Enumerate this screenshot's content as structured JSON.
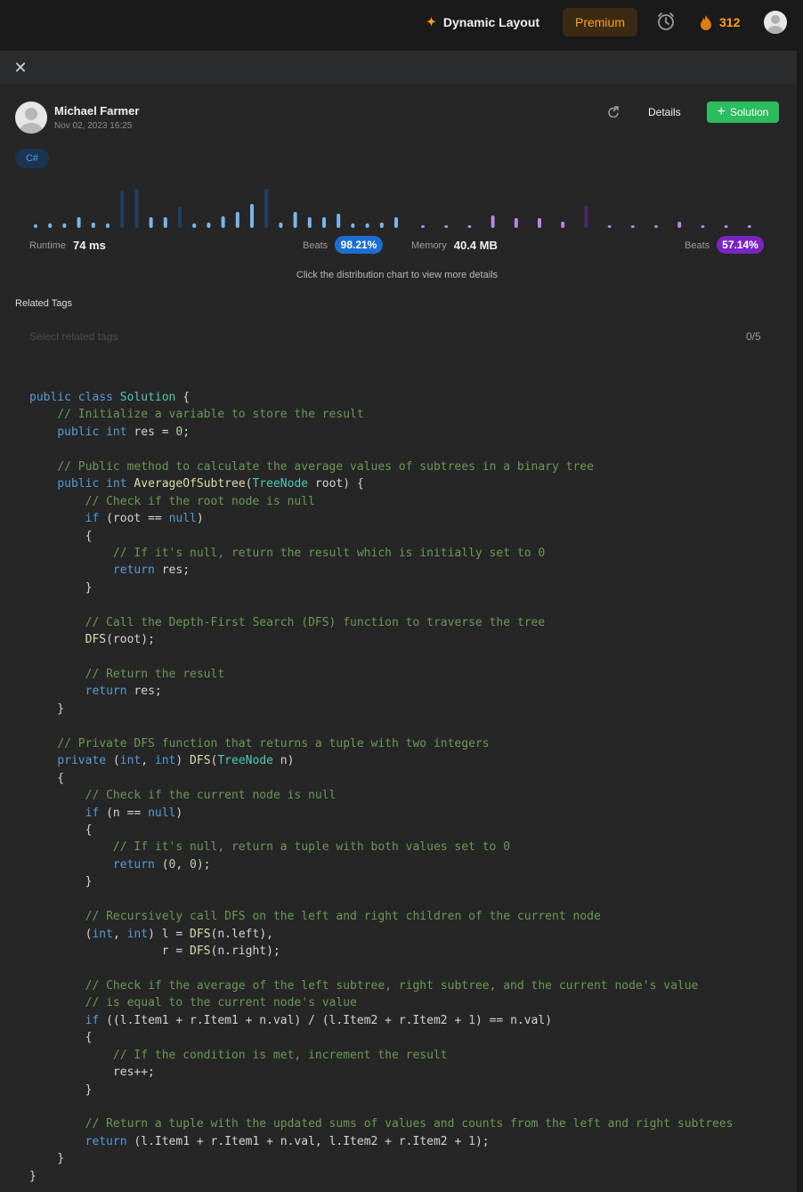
{
  "nav": {
    "layout_label": "Dynamic Layout",
    "premium_label": "Premium",
    "streak_count": "312"
  },
  "author": {
    "name": "Michael Farmer",
    "date": "Nov 02, 2023 16:25"
  },
  "actions": {
    "details_label": "Details",
    "solution_label": "Solution"
  },
  "language": "C#",
  "runtime": {
    "label": "Runtime",
    "value": "74 ms",
    "beats_label": "Beats",
    "beats_value": "98.21%",
    "beats_color": "#1c6fd1",
    "bar_heights": [
      4,
      5,
      5,
      12,
      6,
      5,
      42,
      44,
      12,
      12,
      24,
      5,
      6,
      13,
      18,
      27,
      44,
      6,
      18,
      12,
      12,
      16,
      5,
      5,
      6,
      12
    ],
    "bar_highlight": [
      false,
      false,
      false,
      false,
      false,
      false,
      true,
      true,
      false,
      false,
      true,
      false,
      false,
      false,
      false,
      false,
      true,
      false,
      false,
      false,
      false,
      false,
      false,
      false,
      false,
      false
    ]
  },
  "memory": {
    "label": "Memory",
    "value": "40.4 MB",
    "beats_label": "Beats",
    "beats_value": "57.14%",
    "beats_color": "#7a25c2",
    "bar_heights": [
      3,
      3,
      3,
      14,
      11,
      11,
      7,
      25,
      3,
      3,
      3,
      7,
      3,
      3,
      3
    ],
    "bar_highlight": [
      false,
      false,
      false,
      false,
      false,
      false,
      false,
      true,
      false,
      false,
      false,
      false,
      false,
      false,
      false
    ]
  },
  "chart_hint": "Click the distribution chart to view more details",
  "tags": {
    "label": "Related Tags",
    "placeholder": "Select related tags",
    "count": "0/5"
  },
  "code_lines": [
    [
      [
        "kw",
        "public"
      ],
      [
        "",
        "&nbsp;"
      ],
      [
        "kw",
        "class"
      ],
      [
        "",
        "&nbsp;"
      ],
      [
        "ty",
        "Solution"
      ],
      [
        "",
        "&nbsp;{"
      ]
    ],
    [
      [
        "",
        "    "
      ],
      [
        "cm",
        "// Initialize a variable to store the result"
      ]
    ],
    [
      [
        "",
        "    "
      ],
      [
        "kw",
        "public"
      ],
      [
        "",
        "&nbsp;"
      ],
      [
        "kw",
        "int"
      ],
      [
        "",
        "&nbsp;res = "
      ],
      [
        "nm",
        "0"
      ],
      [
        "",
        ";"
      ]
    ],
    [
      [
        "",
        ""
      ]
    ],
    [
      [
        "",
        "    "
      ],
      [
        "cm",
        "// Public method to calculate the average values of subtrees in a binary tree"
      ]
    ],
    [
      [
        "",
        "    "
      ],
      [
        "kw",
        "public"
      ],
      [
        "",
        "&nbsp;"
      ],
      [
        "kw",
        "int"
      ],
      [
        "",
        "&nbsp;"
      ],
      [
        "fn",
        "AverageOfSubtree"
      ],
      [
        "",
        "("
      ],
      [
        "ty",
        "TreeNode"
      ],
      [
        "",
        "&nbsp;root) {"
      ]
    ],
    [
      [
        "",
        "        "
      ],
      [
        "cm",
        "// Check if the root node is null"
      ]
    ],
    [
      [
        "",
        "        "
      ],
      [
        "kw",
        "if"
      ],
      [
        "",
        "&nbsp;(root == "
      ],
      [
        "kw",
        "null"
      ],
      [
        "",
        ")"
      ]
    ],
    [
      [
        "",
        "        {"
      ]
    ],
    [
      [
        "",
        "            "
      ],
      [
        "cm",
        "// If it's null, return the result which is initially set to 0"
      ]
    ],
    [
      [
        "",
        "            "
      ],
      [
        "kw",
        "return"
      ],
      [
        "",
        "&nbsp;res;"
      ]
    ],
    [
      [
        "",
        "        }"
      ]
    ],
    [
      [
        "",
        ""
      ]
    ],
    [
      [
        "",
        "        "
      ],
      [
        "cm",
        "// Call the Depth-First Search (DFS) function to traverse the tree"
      ]
    ],
    [
      [
        "",
        "        "
      ],
      [
        "fn",
        "DFS"
      ],
      [
        "",
        "(root);"
      ]
    ],
    [
      [
        "",
        ""
      ]
    ],
    [
      [
        "",
        "        "
      ],
      [
        "cm",
        "// Return the result"
      ]
    ],
    [
      [
        "",
        "        "
      ],
      [
        "kw",
        "return"
      ],
      [
        "",
        "&nbsp;res;"
      ]
    ],
    [
      [
        "",
        "    }"
      ]
    ],
    [
      [
        "",
        ""
      ]
    ],
    [
      [
        "",
        "    "
      ],
      [
        "cm",
        "// Private DFS function that returns a tuple with two integers"
      ]
    ],
    [
      [
        "",
        "    "
      ],
      [
        "kw",
        "private"
      ],
      [
        "",
        "&nbsp;("
      ],
      [
        "kw",
        "int"
      ],
      [
        "",
        ",&nbsp;"
      ],
      [
        "kw",
        "int"
      ],
      [
        "",
        ")&nbsp;"
      ],
      [
        "fn",
        "DFS"
      ],
      [
        "",
        "("
      ],
      [
        "ty",
        "TreeNode"
      ],
      [
        "",
        "&nbsp;n)"
      ]
    ],
    [
      [
        "",
        "    {"
      ]
    ],
    [
      [
        "",
        "        "
      ],
      [
        "cm",
        "// Check if the current node is null"
      ]
    ],
    [
      [
        "",
        "        "
      ],
      [
        "kw",
        "if"
      ],
      [
        "",
        "&nbsp;(n == "
      ],
      [
        "kw",
        "null"
      ],
      [
        "",
        ")"
      ]
    ],
    [
      [
        "",
        "        {"
      ]
    ],
    [
      [
        "",
        "            "
      ],
      [
        "cm",
        "// If it's null, return a tuple with both values set to 0"
      ]
    ],
    [
      [
        "",
        "            "
      ],
      [
        "kw",
        "return"
      ],
      [
        "",
        "&nbsp;("
      ],
      [
        "nm",
        "0"
      ],
      [
        "",
        ",&nbsp;"
      ],
      [
        "nm",
        "0"
      ],
      [
        "",
        ");"
      ]
    ],
    [
      [
        "",
        "        }"
      ]
    ],
    [
      [
        "",
        ""
      ]
    ],
    [
      [
        "",
        "        "
      ],
      [
        "cm",
        "// Recursively call DFS on the left and right children of the current node"
      ]
    ],
    [
      [
        "",
        "        ("
      ],
      [
        "kw",
        "int"
      ],
      [
        "",
        ",&nbsp;"
      ],
      [
        "kw",
        "int"
      ],
      [
        "",
        ")&nbsp;l = "
      ],
      [
        "fn",
        "DFS"
      ],
      [
        "",
        "(n.left),"
      ]
    ],
    [
      [
        "",
        "                   r = "
      ],
      [
        "fn",
        "DFS"
      ],
      [
        "",
        "(n.right);"
      ]
    ],
    [
      [
        "",
        ""
      ]
    ],
    [
      [
        "",
        "        "
      ],
      [
        "cm",
        "// Check if the average of the left subtree, right subtree, and the current node's value"
      ]
    ],
    [
      [
        "",
        "        "
      ],
      [
        "cm",
        "// is equal to the current node's value"
      ]
    ],
    [
      [
        "",
        "        "
      ],
      [
        "kw",
        "if"
      ],
      [
        "",
        "&nbsp;((l.Item1 + r.Item1 + n.val) / (l.Item2 + r.Item2 + "
      ],
      [
        "nm",
        "1"
      ],
      [
        "",
        ") == n.val)"
      ]
    ],
    [
      [
        "",
        "        {"
      ]
    ],
    [
      [
        "",
        "            "
      ],
      [
        "cm",
        "// If the condition is met, increment the result"
      ]
    ],
    [
      [
        "",
        "            res++;"
      ]
    ],
    [
      [
        "",
        "        }"
      ]
    ],
    [
      [
        "",
        ""
      ]
    ],
    [
      [
        "",
        "        "
      ],
      [
        "cm",
        "// Return a tuple with the updated sums of values and counts from the left and right subtrees"
      ]
    ],
    [
      [
        "",
        "        "
      ],
      [
        "kw",
        "return"
      ],
      [
        "",
        "&nbsp;(l.Item1 + r.Item1 + n.val, l.Item2 + r.Item2 + "
      ],
      [
        "nm",
        "1"
      ],
      [
        "",
        ");"
      ]
    ],
    [
      [
        "",
        "    }"
      ]
    ],
    [
      [
        "",
        "}"
      ]
    ]
  ]
}
